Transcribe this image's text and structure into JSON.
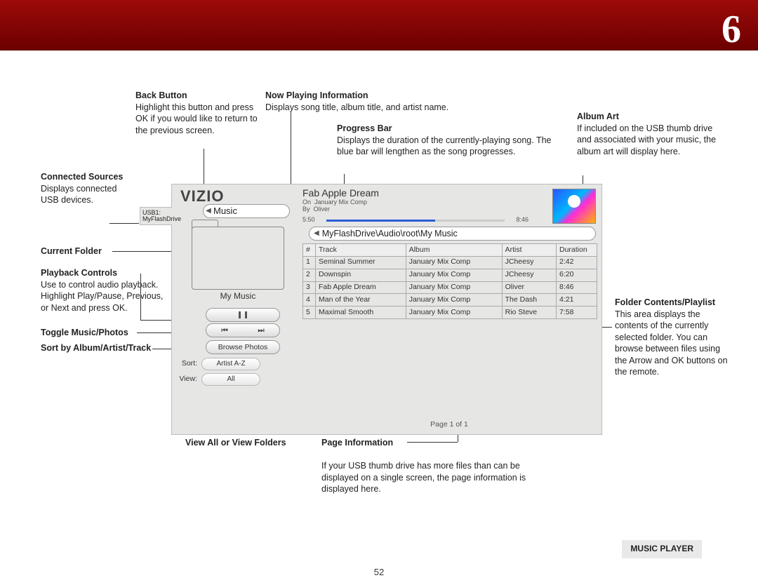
{
  "chapter": "6",
  "page_number": "52",
  "footer_label": "MUSIC PLAYER",
  "callouts": {
    "back": {
      "title": "Back Button",
      "body": "Highlight this button and press OK if you would like to return to the previous screen."
    },
    "nowplaying": {
      "title": "Now Playing Information",
      "body": "Displays song title, album title, and artist name."
    },
    "progress": {
      "title": "Progress Bar",
      "body": "Displays the duration of the currently-playing song. The blue bar will lengthen as the song progresses."
    },
    "albumart": {
      "title": "Album Art",
      "body": "If included on the USB thumb drive and associated with your music, the album art will display here."
    },
    "connected": {
      "title": "Connected Sources",
      "body": "Displays connected USB devices."
    },
    "current_folder": "Current Folder",
    "playback": {
      "title": "Playback Controls",
      "body": "Use to control audio playback. Highlight Play/Pause, Previous, or Next and press OK."
    },
    "toggle": "Toggle Music/Photos",
    "sort": "Sort by Album/Artist/Track",
    "viewall": "View All or View Folders",
    "pageinfo": {
      "title": "Page Information",
      "body": "If your USB thumb drive has more files than can be displayed on a single screen, the page information is displayed here."
    },
    "folder_contents": {
      "title": "Folder Contents/Playlist",
      "body": "This area displays the contents of the currently selected folder. You can browse between files using the Arrow and OK buttons on the remote."
    }
  },
  "screen": {
    "brand": "VIZIO",
    "usb_badge_line1": "USB1:",
    "usb_badge_line2": "MyFlashDrive",
    "music_label": "Music",
    "folder_name": "My Music",
    "playpause_icon": "pause-icon",
    "browse_photos": "Browse Photos",
    "sort_label": "Sort:",
    "sort_value": "Artist A-Z",
    "view_label": "View:",
    "view_value": "All",
    "now_title": "Fab Apple Dream",
    "now_on_label": "On",
    "now_on": "January Mix Comp",
    "now_by_label": "By",
    "now_by": "Oliver",
    "elapsed": "5:50",
    "total": "8:46",
    "path": "MyFlashDrive\\Audio\\root\\My Music",
    "headers": {
      "num": "#",
      "track": "Track",
      "album": "Album",
      "artist": "Artist",
      "duration": "Duration"
    },
    "tracks": [
      {
        "n": "1",
        "track": "Seminal Summer",
        "album": "January Mix Comp",
        "artist": "JCheesy",
        "dur": "2:42"
      },
      {
        "n": "2",
        "track": "Downspin",
        "album": "January Mix Comp",
        "artist": "JCheesy",
        "dur": "6:20"
      },
      {
        "n": "3",
        "track": "Fab Apple Dream",
        "album": "January Mix Comp",
        "artist": "Oliver",
        "dur": "8:46"
      },
      {
        "n": "4",
        "track": "Man of the Year",
        "album": "January Mix Comp",
        "artist": "The Dash",
        "dur": "4:21"
      },
      {
        "n": "5",
        "track": "Maximal Smooth",
        "album": "January Mix Comp",
        "artist": "Rio Steve",
        "dur": "7:58"
      }
    ],
    "page_info": "Page 1 of 1"
  }
}
